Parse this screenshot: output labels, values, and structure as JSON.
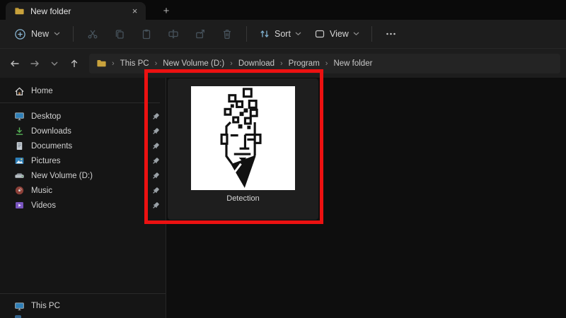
{
  "tab_bar": {
    "tabs": [
      {
        "title": "New folder",
        "icon": "folder-icon"
      }
    ],
    "close_glyph": "×",
    "new_tab_glyph": "+"
  },
  "toolbar": {
    "new_button": {
      "label": "New",
      "icon": "plus-circle-icon"
    },
    "icon_buttons": [
      {
        "icon": "cut-icon",
        "state": "disabled"
      },
      {
        "icon": "copy-icon",
        "state": "disabled"
      },
      {
        "icon": "paste-icon",
        "state": "disabled"
      },
      {
        "icon": "rename-icon",
        "state": "disabled"
      },
      {
        "icon": "share-icon",
        "state": "disabled"
      },
      {
        "icon": "delete-icon",
        "state": "disabled"
      }
    ],
    "sort_button": {
      "label": "Sort",
      "icon": "sort-arrows-icon"
    },
    "view_button": {
      "label": "View",
      "icon": "view-square-icon"
    },
    "more_button": {
      "icon": "ellipsis-icon"
    }
  },
  "navigation": {
    "buttons": [
      "back",
      "forward",
      "recent-locations",
      "up"
    ]
  },
  "breadcrumb": {
    "separator_glyph": "›",
    "items": [
      "This PC",
      "New Volume (D:)",
      "Download",
      "Program",
      "New folder"
    ]
  },
  "sidebar": {
    "home": {
      "label": "Home",
      "icon": "home-icon"
    },
    "pinned_items": [
      {
        "label": "Desktop",
        "icon": "desktop-icon",
        "pinned": true
      },
      {
        "label": "Downloads",
        "icon": "downloads-icon",
        "pinned": true
      },
      {
        "label": "Documents",
        "icon": "documents-icon",
        "pinned": true
      },
      {
        "label": "Pictures",
        "icon": "pictures-icon",
        "pinned": true
      },
      {
        "label": "New Volume (D:)",
        "icon": "drive-icon",
        "pinned": true
      },
      {
        "label": "Music",
        "icon": "music-icon",
        "pinned": true
      },
      {
        "label": "Videos",
        "icon": "videos-icon",
        "pinned": true
      }
    ],
    "bottom_items": [
      {
        "label": "This PC",
        "icon": "monitor-icon"
      }
    ]
  },
  "content": {
    "files": [
      {
        "name": "Detection",
        "icon": "detection-face-art-icon"
      }
    ]
  },
  "annotation": {
    "type": "highlight-rectangle",
    "color": "#ec1111"
  },
  "colors": {
    "annotation_red": "#ec1111",
    "folder_yellow": "#c9a23c",
    "accent_blue": "#7fb0cf",
    "toolbar_bg": "#1d1d1d",
    "content_bg": "#0e0e0e"
  }
}
